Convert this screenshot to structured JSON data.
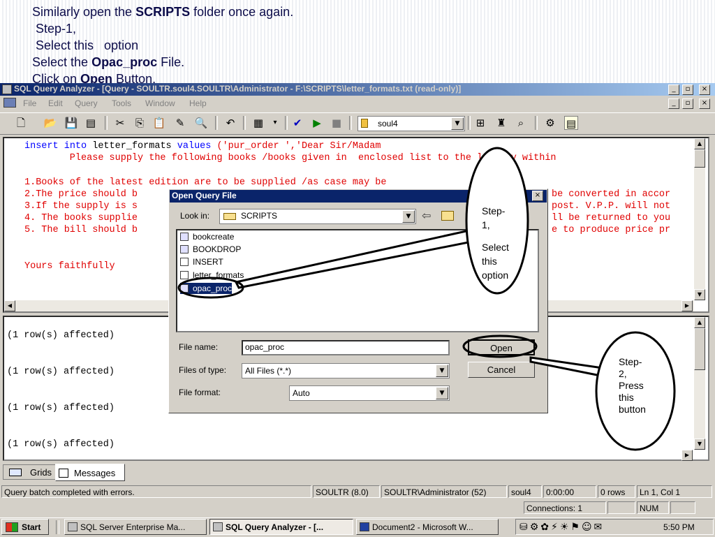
{
  "instructions": {
    "line1_pre": "Similarly open the ",
    "line1_bold": "SCRIPTS",
    "line1_post": " folder once again.",
    "line2": " Step-1,",
    "line3": " Select this   option",
    "line4_pre": "Select the ",
    "line4_bold": "Opac_proc",
    "line4_post": " File.",
    "line5_pre": "Click on ",
    "line5_bold": "Open",
    "line5_post": " Button."
  },
  "window": {
    "title": "SQL Query Analyzer - [Query - SOULTR.soul4.SOULTR\\Administrator - F:\\SCRIPTS\\letter_formats.txt (read-only)]",
    "controls": [
      "_",
      "▫",
      "×"
    ]
  },
  "menu": [
    "File",
    "Edit",
    "Query",
    "Tools",
    "Window",
    "Help"
  ],
  "toolbar": {
    "database": "soul4"
  },
  "editor": {
    "line1_kw1": "insert",
    "line1_kw2": "into",
    "line1_plain": "letter_formats",
    "line1_kw3": "values",
    "line1_str": "('pur_order ','Dear Sir/Madam",
    "line2": "        Please supply the following books /books given in  enclosed list to the library within",
    "line3": "1.Books of the latest edition are to be supplied /as case may be",
    "line4": "2.The price should b",
    "line4b": "be converted in accor",
    "line5": "3.If the supply is s",
    "line5b": "post. V.P.P. will not",
    "line6": "4. The books supplie",
    "line6b": "ll be returned to you",
    "line7": "5. The bill should b",
    "line7b": "e to produce price pr",
    "line8": "Yours faithfully"
  },
  "results": {
    "lines": [
      "(1 row(s) affected)",
      "(1 row(s) affected)",
      "(1 row(s) affected)",
      "(1 row(s) affected)"
    ]
  },
  "tabs": {
    "grids": "Grids",
    "messages": "Messages"
  },
  "status": {
    "message": "Query batch completed with errors.",
    "server": "SOULTR (8.0)",
    "user": "SOULTR\\Administrator (52)",
    "db": "soul4",
    "time": "0:00:00",
    "rows": "0 rows",
    "position": "Ln 1, Col 1",
    "connections": "Connections: 1",
    "num": "NUM"
  },
  "dialog": {
    "title": "Open Query File",
    "look_in_label": "Look in:",
    "look_in_value": "SCRIPTS",
    "files": [
      "bookcreate",
      "BOOKDROP",
      "INSERT",
      "letter_formats",
      "opac_proc"
    ],
    "file_name_label": "File name:",
    "file_name_value": "opac_proc",
    "files_of_type_label": "Files of type:",
    "files_of_type_value": "All Files (*.*)",
    "file_format_label": "File format:",
    "file_format_value": "Auto",
    "open_button": "Open",
    "cancel_button": "Cancel",
    "close": "×"
  },
  "callouts": {
    "step1": [
      "Step-",
      "1,",
      "",
      "Select",
      "this",
      "option"
    ],
    "step2": [
      "Step-",
      "2,",
      "Press",
      "this",
      "button"
    ]
  },
  "taskbar": {
    "start": "Start",
    "tasks": [
      "SQL Server Enterprise Ma...",
      "SQL Query Analyzer - [...",
      "Document2 - Microsoft W..."
    ],
    "clock": "5:50 PM"
  }
}
